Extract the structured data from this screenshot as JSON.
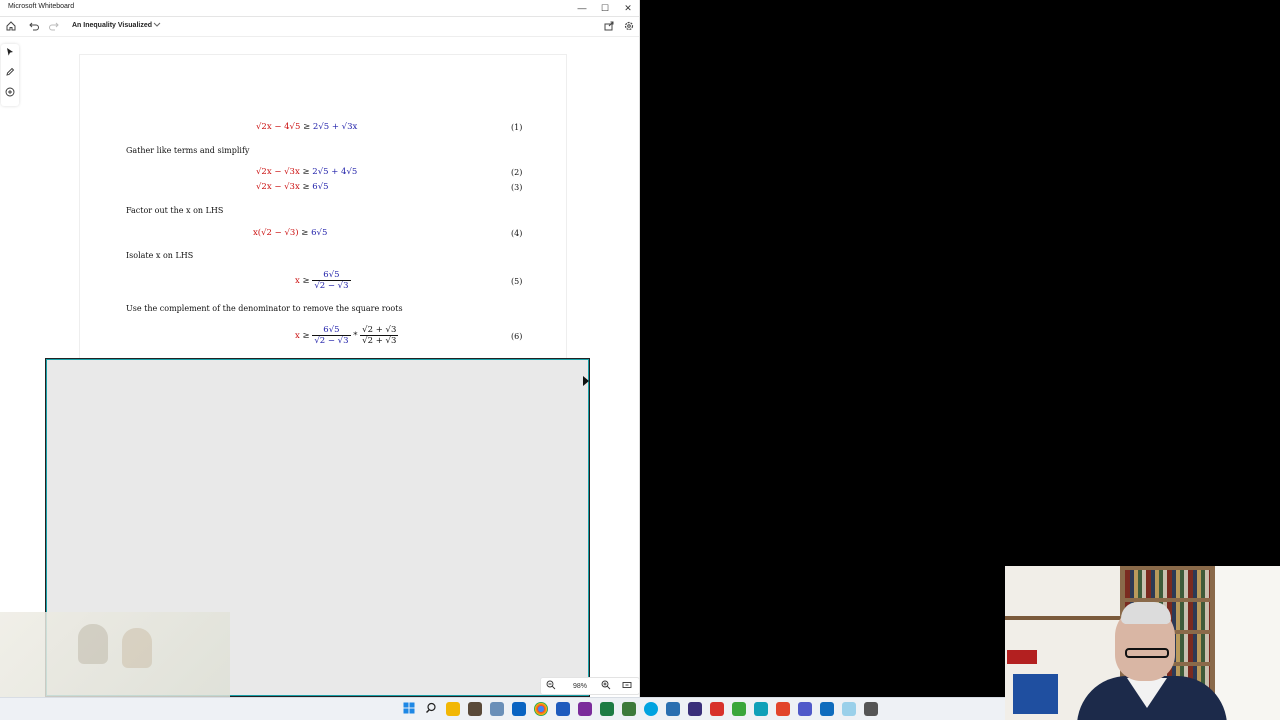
{
  "window": {
    "app_title": "Microsoft Whiteboard",
    "controls": {
      "minimize": "—",
      "maximize": "☐",
      "close": "✕"
    }
  },
  "toolbar": {
    "doc_title": "An Inequality Visualized",
    "icons": [
      "home-icon",
      "undo-icon",
      "redo-icon",
      "chevron-down-icon",
      "share-icon",
      "settings-icon"
    ]
  },
  "left_tools": [
    "select-icon",
    "pen-icon",
    "add-icon"
  ],
  "document": {
    "prose": [
      "Gather like terms and simplify",
      "Factor out the x on LHS",
      "Isolate x on LHS",
      "Use the complement of the denominator to remove the square roots"
    ],
    "eq_numbers": [
      "(1)",
      "(2)",
      "(3)",
      "(4)",
      "(5)",
      "(6)"
    ],
    "eq1": {
      "lhs": "√2x − 4√5",
      "rel": " ≥ ",
      "rhs": "2√5 + √3x"
    },
    "eq2": {
      "lhs": "√2x − √3x",
      "rel": " ≥ ",
      "rhs": "2√5 + 4√5"
    },
    "eq3": {
      "lhs": "√2x − √3x",
      "rel": " ≥ ",
      "rhs": "6√5"
    },
    "eq4": {
      "lhs": "x(√2 − √3)",
      "rel": " ≥ ",
      "rhs": "6√5"
    },
    "eq5": {
      "lhs": "x",
      "rel": " ≥ ",
      "num": "6√5",
      "den": "√2 − √3"
    },
    "eq6": {
      "lhs": "x",
      "rel": " ≥ ",
      "num": "6√5",
      "den": "√2 − √3",
      "times": " * ",
      "num2": "√2 + √3",
      "den2": "√2 + √3"
    },
    "colors": {
      "lhs": "#cc1111",
      "rhs": "#2222aa"
    }
  },
  "zoom": {
    "value": "98%",
    "icons": [
      "zoom-out-icon",
      "zoom-in-icon",
      "fit-screen-icon"
    ]
  },
  "taskbar": {
    "apps": [
      "windows-start-icon",
      "search-icon",
      "file-explorer-icon",
      "photos-icon",
      "snip-icon",
      "outlook-icon",
      "chrome-icon",
      "word-icon",
      "onenote-icon",
      "excel-icon",
      "visio-icon",
      "skype-icon",
      "app-icon",
      "camtasia-icon",
      "camtasia-rec-icon",
      "snagit-icon",
      "snagit-editor-icon",
      "teams-icon",
      "mail-icon",
      "whiteboard-icon",
      "tablet-icon"
    ]
  }
}
